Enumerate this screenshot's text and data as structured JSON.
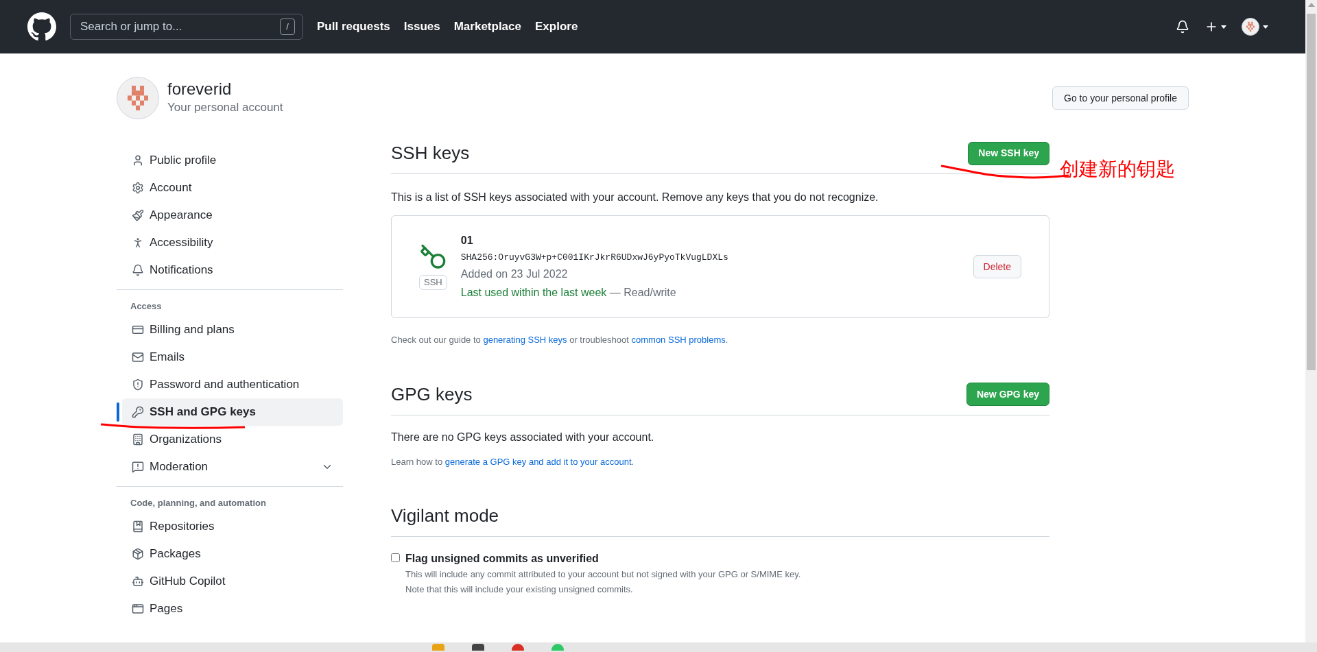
{
  "nav": {
    "search_placeholder": "Search or jump to...",
    "slash_key": "/",
    "links": [
      "Pull requests",
      "Issues",
      "Marketplace",
      "Explore"
    ]
  },
  "account": {
    "name": "foreverid",
    "subtitle": "Your personal account",
    "profile_button": "Go to your personal profile"
  },
  "sidebar": {
    "groups": [
      {
        "items": [
          {
            "label": "Public profile",
            "kind": "link",
            "selected": false
          },
          {
            "label": "Account",
            "kind": "link",
            "selected": false
          },
          {
            "label": "Appearance",
            "kind": "link",
            "selected": false
          },
          {
            "label": "Accessibility",
            "kind": "link",
            "selected": false
          },
          {
            "label": "Notifications",
            "kind": "link",
            "selected": false
          }
        ]
      },
      {
        "heading": "Access",
        "items": [
          {
            "label": "Billing and plans",
            "kind": "link",
            "selected": false
          },
          {
            "label": "Emails",
            "kind": "link",
            "selected": false
          },
          {
            "label": "Password and authentication",
            "kind": "link",
            "selected": false
          },
          {
            "label": "SSH and GPG keys",
            "kind": "link",
            "selected": true
          },
          {
            "label": "Organizations",
            "kind": "link",
            "selected": false
          },
          {
            "label": "Moderation",
            "kind": "group",
            "expanded": false,
            "selected": false
          }
        ]
      },
      {
        "heading": "Code, planning, and automation",
        "items": [
          {
            "label": "Repositories",
            "kind": "link",
            "selected": false
          },
          {
            "label": "Packages",
            "kind": "link",
            "selected": false
          },
          {
            "label": "GitHub Copilot",
            "kind": "link",
            "selected": false
          },
          {
            "label": "Pages",
            "kind": "link",
            "selected": false
          }
        ]
      }
    ]
  },
  "ssh": {
    "title": "SSH keys",
    "new_button": "New SSH key",
    "description": "This is a list of SSH keys associated with your account. Remove any keys that you do not recognize.",
    "keys": [
      {
        "badge": "SSH",
        "title": "01",
        "fingerprint": "SHA256:OruyvG3W+p+C001IKrJkrR6UDxwJ6yPyoTkVugLDXLs",
        "added": "Added on 23 Jul 2022",
        "last_used": "Last used within the last week",
        "access": "— Read/write",
        "delete": "Delete"
      }
    ],
    "guide": [
      {
        "text": "Check out our guide to ",
        "link": false
      },
      {
        "text": "generating SSH keys",
        "link": true
      },
      {
        "text": " or troubleshoot ",
        "link": false
      },
      {
        "text": "common SSH problems",
        "link": true
      },
      {
        "text": ".",
        "link": false
      }
    ]
  },
  "gpg": {
    "title": "GPG keys",
    "new_button": "New GPG key",
    "empty": "There are no GPG keys associated with your account.",
    "guide": [
      {
        "text": "Learn how to ",
        "link": false
      },
      {
        "text": "generate a GPG key and add it to your account",
        "link": true
      },
      {
        "text": ".",
        "link": false
      }
    ]
  },
  "vigilant": {
    "title": "Vigilant mode",
    "option": {
      "label": "Flag unsigned commits as unverified",
      "checked": false,
      "description": [
        "This will include any commit attributed to your account but not signed with your GPG or S/MIME key.",
        "Note that this will include your existing unsigned commits."
      ]
    }
  },
  "annotation": {
    "text": "创建新的钥匙"
  }
}
